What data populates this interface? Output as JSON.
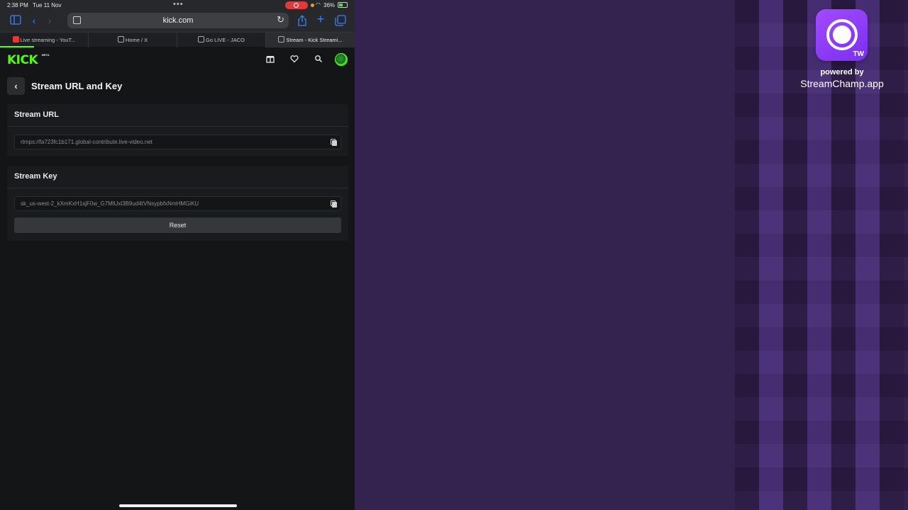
{
  "status_bar": {
    "time": "2:38 PM",
    "date": "Tue 11 Nov",
    "battery": "36%"
  },
  "browser": {
    "url": "kick.com",
    "tabs": [
      {
        "label": "Live streaming - YouT...",
        "favicon": "youtube-icon"
      },
      {
        "label": "Home / X",
        "favicon": "x-icon"
      },
      {
        "label": "Go LIVE - JACO",
        "favicon": "page-icon"
      },
      {
        "label": "Stream - Kick Streami...",
        "favicon": "kick-icon",
        "active": true
      }
    ]
  },
  "site": {
    "logo": "KICK",
    "logo_badge": "BETA",
    "accent_color": "#53fc18"
  },
  "page": {
    "title": "Stream URL and Key",
    "stream_url": {
      "heading": "Stream URL",
      "value": "rtmps://fa723fc1b171.global-contribute.live-video.net"
    },
    "stream_key": {
      "heading": "Stream Key",
      "value": "sk_us-west-2_kXmKxH1sjF0w_G7MlUxl3B9ud4tVNsypbfxNmHMGiKU"
    },
    "reset_label": "Reset"
  },
  "overlay": {
    "badge_label": "TW",
    "powered_by": "powered by",
    "app_name": "StreamChamp.app",
    "background_color": "#34224f"
  }
}
